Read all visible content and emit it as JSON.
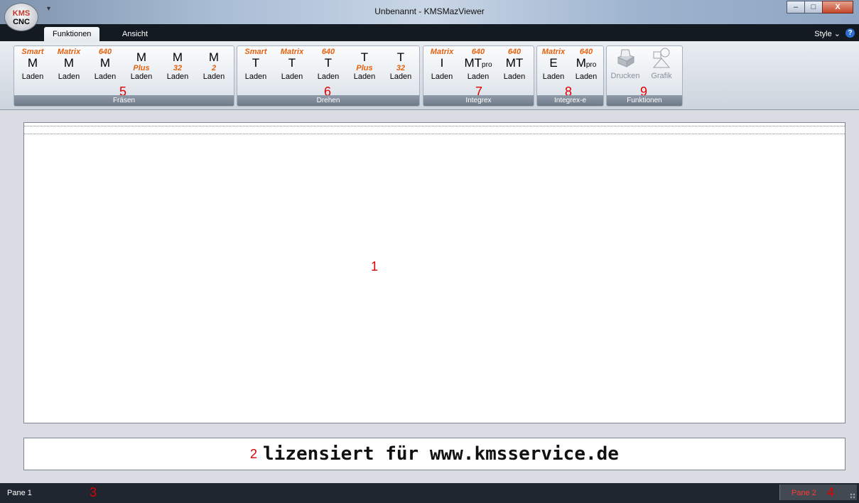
{
  "titlebar": {
    "title": "Unbenannt - KMSMazViewer",
    "logo_line1": "KMS",
    "logo_line2": "CNC",
    "quick_access": "▾",
    "minimize": "–",
    "maximize": "□",
    "close": "X"
  },
  "tabs": {
    "active": "Funktionen",
    "inactive": "Ansicht"
  },
  "style_menu": "Style ⌄",
  "help": "?",
  "groups": {
    "fraesen": {
      "label": "Fräsen",
      "marker": "5",
      "buttons": [
        {
          "top": "Smart",
          "letter": "M",
          "label": "Laden"
        },
        {
          "top": "Matrix",
          "letter": "M",
          "label": "Laden"
        },
        {
          "top": "640",
          "letter": "M",
          "label": "Laden"
        },
        {
          "letter": "M",
          "mid": "Plus",
          "label": "Laden"
        },
        {
          "letter": "M",
          "mid": "32",
          "label": "Laden"
        },
        {
          "letter": "M",
          "mid": "2",
          "label": "Laden"
        }
      ]
    },
    "drehen": {
      "label": "Drehen",
      "marker": "6",
      "buttons": [
        {
          "top": "Smart",
          "letter": "T",
          "label": "Laden"
        },
        {
          "top": "Matrix",
          "letter": "T",
          "label": "Laden"
        },
        {
          "top": "640",
          "letter": "T",
          "label": "Laden"
        },
        {
          "letter": "T",
          "mid": "Plus",
          "label": "Laden"
        },
        {
          "letter": "T",
          "mid": "32",
          "label": "Laden"
        }
      ]
    },
    "integrex": {
      "label": "Integrex",
      "marker": "7",
      "buttons": [
        {
          "top": "Matrix",
          "letter": "I",
          "label": "Laden"
        },
        {
          "top": "640",
          "letter": "MT",
          "sub": "pro",
          "label": "Laden"
        },
        {
          "top": "640",
          "letter": "MT",
          "label": "Laden"
        }
      ]
    },
    "integrex_e": {
      "label": "Integrex-e",
      "marker": "8",
      "buttons": [
        {
          "top": "Matrix",
          "letter": "E",
          "label": "Laden"
        },
        {
          "top": "640",
          "letter": "M",
          "sub": "pro",
          "label": "Laden"
        }
      ]
    },
    "funktionen": {
      "label": "Funktionen",
      "marker": "9",
      "buttons": [
        {
          "icon": "printer-icon",
          "label": "Drucken"
        },
        {
          "icon": "shapes-icon",
          "label": "Grafik"
        }
      ]
    }
  },
  "content": {
    "marker": "1"
  },
  "license": {
    "marker": "2",
    "text": "lizensiert für www.kmsservice.de"
  },
  "statusbar": {
    "pane1": "Pane 1",
    "pane1_marker": "3",
    "pane2": "Pane 2",
    "pane2_marker": "4"
  }
}
